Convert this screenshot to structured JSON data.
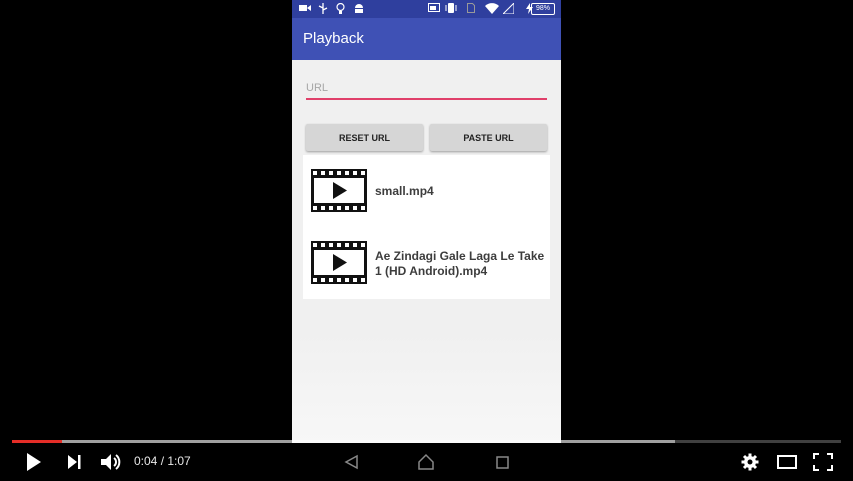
{
  "app": {
    "title": "Playback"
  },
  "status_bar": {
    "battery": "98%"
  },
  "url_field": {
    "placeholder": "URL",
    "value": ""
  },
  "buttons": {
    "reset_label": "RESET URL",
    "paste_label": "PASTE URL"
  },
  "videos": [
    {
      "name": "small.mp4"
    },
    {
      "name": "Ae Zindagi Gale Laga Le Take 1 (HD Android).mp4"
    }
  ],
  "player": {
    "current_time": "0:04",
    "separator": " / ",
    "total_time": "1:07",
    "played_fraction": 0.06,
    "buffered_fraction": 0.8,
    "accent_color": "#e52d27"
  }
}
